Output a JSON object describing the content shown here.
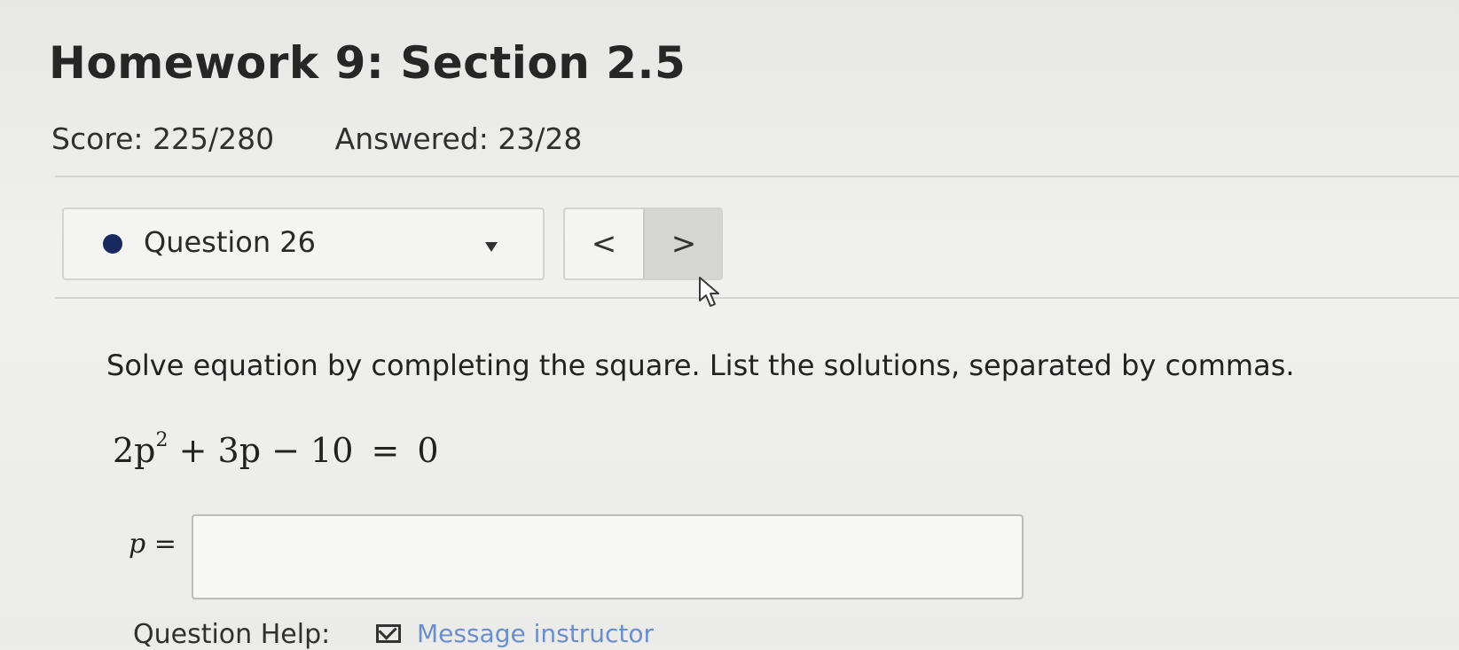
{
  "header": {
    "title": "Homework 9: Section 2.5",
    "score": "Score: 225/280",
    "answered": "Answered: 23/28"
  },
  "question_nav": {
    "current_question": "Question 26",
    "status_color": "#17295e",
    "prev_icon": "chevron-left-icon",
    "next_icon": "chevron-right-icon",
    "prev_label": "<",
    "next_label": ">"
  },
  "question": {
    "prompt": "Solve equation by completing the square. List the solutions, separated by commas.",
    "equation": {
      "coef": "2p",
      "power": "2",
      "rest": "+ 3p − 10",
      "eq": "=",
      "rhs": "0"
    },
    "answer_variable": "p",
    "answer_equals": "=",
    "answer_value": ""
  },
  "help": {
    "label": "Question Help:",
    "message_link": "Message instructor",
    "message_icon": "mail-icon"
  }
}
